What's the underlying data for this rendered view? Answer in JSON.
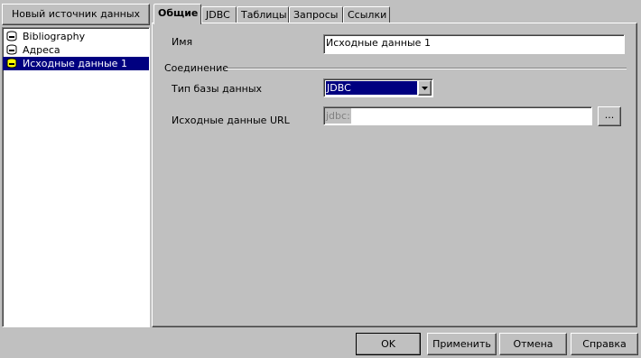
{
  "left_panel": {
    "new_source_label": "Новый источник данных",
    "sources": [
      {
        "label": "Bibliography",
        "icon": "database-icon",
        "selected": false
      },
      {
        "label": "Адреса",
        "icon": "database-icon",
        "selected": false
      },
      {
        "label": "Исходные данные 1",
        "icon": "database-new-icon",
        "selected": true
      }
    ]
  },
  "tabs": [
    {
      "label": "Общие",
      "active": true
    },
    {
      "label": "JDBC",
      "active": false
    },
    {
      "label": "Таблицы",
      "active": false
    },
    {
      "label": "Запросы",
      "active": false
    },
    {
      "label": "Ссылки",
      "active": false
    }
  ],
  "general": {
    "name_label": "Имя",
    "name_value": "Исходные данные 1",
    "connection_section": "Соединение",
    "db_type_label": "Тип базы данных",
    "db_type_value": "JDBC",
    "url_label": "Исходные данные URL",
    "url_prefix": "jdbc:",
    "url_value": "",
    "browse_label": "..."
  },
  "buttons": {
    "ok": "OK",
    "apply": "Применить",
    "cancel": "Отмена",
    "help": "Справка"
  },
  "colors": {
    "face": "#c0c0c0",
    "selection": "#000080"
  }
}
